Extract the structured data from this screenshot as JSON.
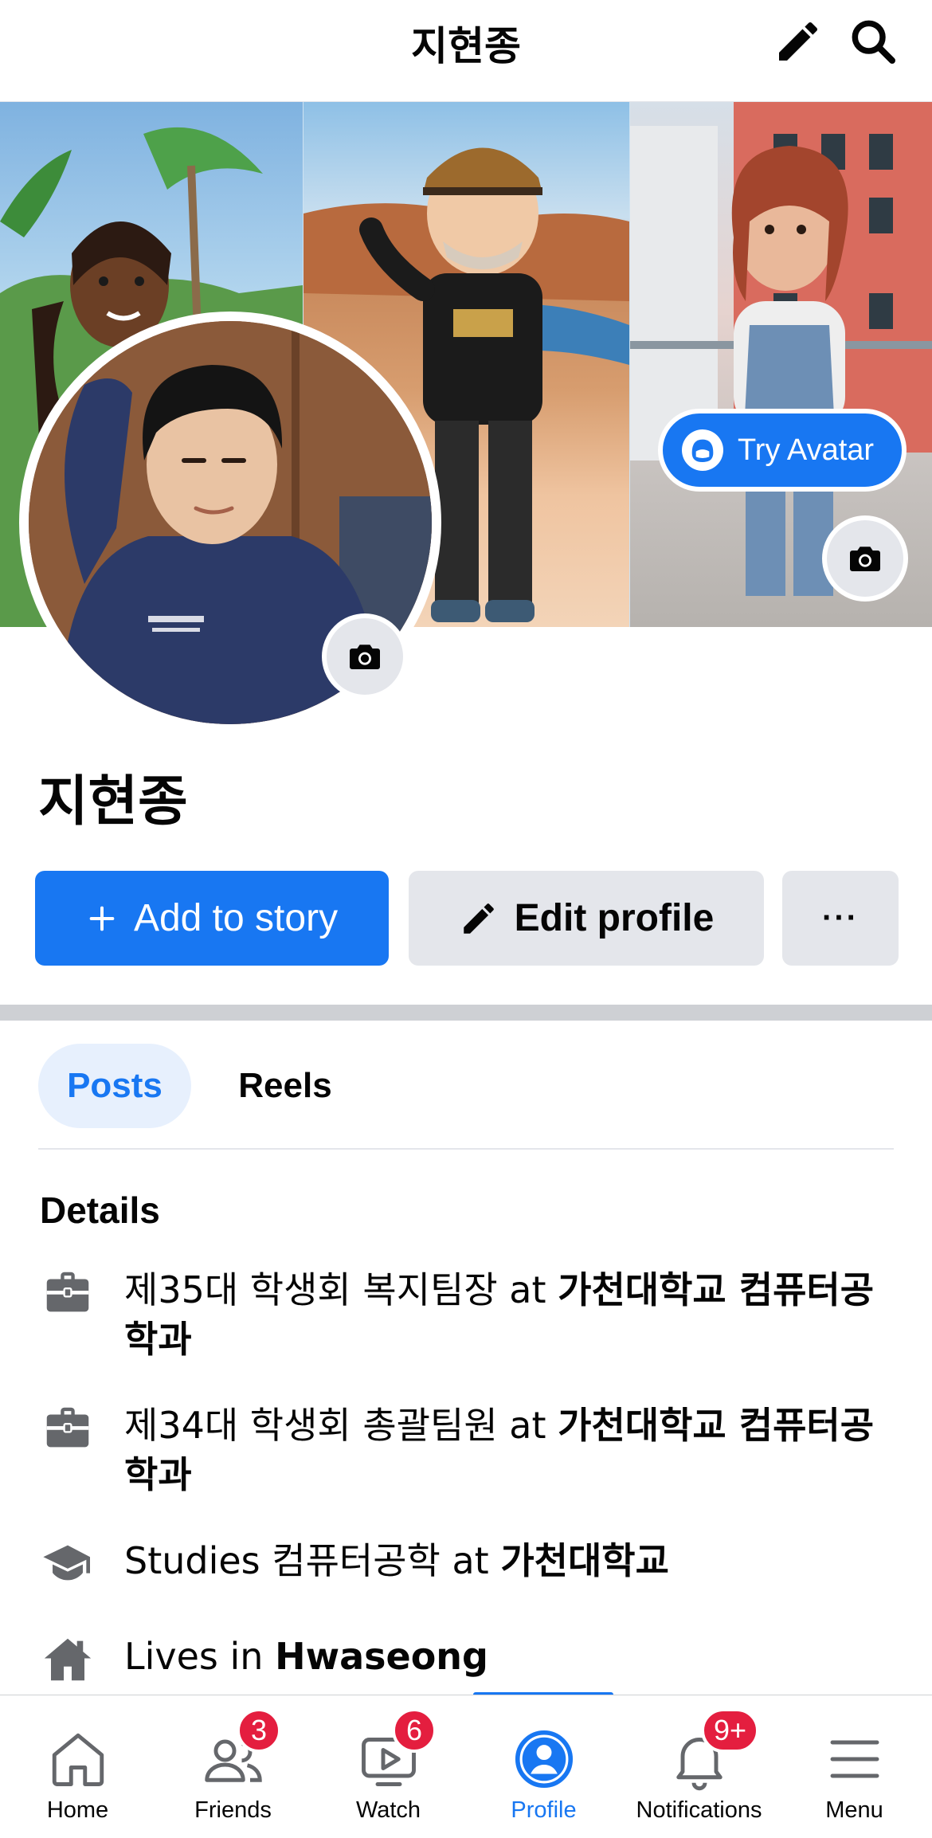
{
  "header": {
    "title": "지현종"
  },
  "cover": {
    "try_avatar_label": "Try Avatar"
  },
  "profile": {
    "name": "지현종"
  },
  "actions": {
    "add_story": "Add to story",
    "edit_profile": "Edit profile",
    "more": "···"
  },
  "tabs": [
    {
      "label": "Posts",
      "active": true
    },
    {
      "label": "Reels",
      "active": false
    }
  ],
  "details": {
    "title": "Details",
    "items": [
      {
        "icon": "briefcase-icon",
        "prefix": "제35대 학생회 복지팀장 at ",
        "bold": "가천대학교 컴퓨터공학과"
      },
      {
        "icon": "briefcase-icon",
        "prefix": "제34대 학생회 총괄팀원 at ",
        "bold": "가천대학교 컴퓨터공학과"
      },
      {
        "icon": "graduation-cap-icon",
        "prefix": "Studies 컴퓨터공학 at ",
        "bold": "가천대학교"
      },
      {
        "icon": "home-icon",
        "prefix": "Lives in ",
        "bold": "Hwaseong"
      }
    ]
  },
  "nav": [
    {
      "label": "Home",
      "icon": "home-icon",
      "badge": ""
    },
    {
      "label": "Friends",
      "icon": "friends-icon",
      "badge": "3"
    },
    {
      "label": "Watch",
      "icon": "watch-icon",
      "badge": "6"
    },
    {
      "label": "Profile",
      "icon": "profile-icon",
      "badge": "",
      "active": true
    },
    {
      "label": "Notifications",
      "icon": "bell-icon",
      "badge": "9+"
    },
    {
      "label": "Menu",
      "icon": "menu-icon",
      "badge": ""
    }
  ],
  "colors": {
    "accent": "#1877f2",
    "badge": "#e41e3f",
    "button_gray": "#e4e6eb"
  }
}
